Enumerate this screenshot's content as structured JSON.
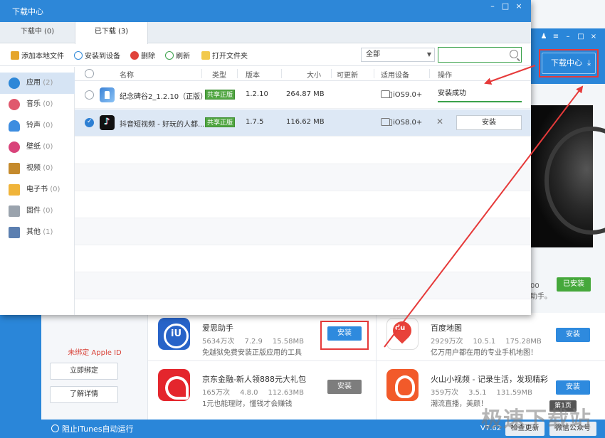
{
  "background": {
    "download_center_btn": "下载中心",
    "unbind_label": "未绑定 Apple ID",
    "bind_now": "立即绑定",
    "learn_more": "了解详情",
    "peek_text": [
      "00",
      "助手。"
    ],
    "installed_btn": "已安装",
    "apps": [
      {
        "name": "爱思助手",
        "downloads": "5634万次",
        "version": "7.2.9",
        "size": "15.58MB",
        "desc": "免越狱免费安装正版应用的工具",
        "button": "安装"
      },
      {
        "name": "百度地图",
        "downloads": "2929万次",
        "version": "10.5.1",
        "size": "175.28MB",
        "desc": "亿万用户都在用的专业手机地图！",
        "button": "安装"
      },
      {
        "name": "京东金融-新人领888元大礼包",
        "downloads": "165万次",
        "version": "4.8.0",
        "size": "112.63MB",
        "desc": "1元也能理财，懂钱才会赚钱",
        "button": "安装"
      },
      {
        "name": "火山小视频 - 记录生活，发现精彩",
        "downloads": "359万次",
        "version": "3.5.1",
        "size": "131.59MB",
        "desc": "潮流直播，美颜！",
        "button": "安装"
      }
    ],
    "status_bar": {
      "itunes_block": "阻止iTunes自动运行",
      "version": "V7.62",
      "check_update": "检查更新",
      "wechat": "微信公众号"
    },
    "page_badge": "第1页",
    "watermark": "极速下载站"
  },
  "dialog": {
    "title": "下载中心",
    "tabs": [
      {
        "label": "下载中 (0)"
      },
      {
        "label": "已下载 (3)"
      }
    ],
    "toolbar": {
      "add_local": "添加本地文件",
      "install_device": "安装到设备",
      "delete": "删除",
      "refresh": "刷新",
      "open_folder": "打开文件夹"
    },
    "filter_selected": "全部",
    "search_placeholder": "",
    "sidebar": [
      {
        "label": "应用",
        "count": "(2)"
      },
      {
        "label": "音乐",
        "count": "(0)"
      },
      {
        "label": "铃声",
        "count": "(0)"
      },
      {
        "label": "壁纸",
        "count": "(0)"
      },
      {
        "label": "视频",
        "count": "(0)"
      },
      {
        "label": "电子书",
        "count": "(0)"
      },
      {
        "label": "固件",
        "count": "(0)"
      },
      {
        "label": "其他",
        "count": "(1)"
      }
    ],
    "columns": {
      "name": "名称",
      "type": "类型",
      "version": "版本",
      "size": "大小",
      "updatable": "可更新",
      "device": "适用设备",
      "action": "操作"
    },
    "rows": [
      {
        "name": "纪念碑谷2_1.2.10（正版）",
        "type": "共享正版",
        "version": "1.2.10",
        "size": "264.87 MB",
        "device": "iOS9.0+",
        "status": "安装成功",
        "progress": 100
      },
      {
        "name": "抖音短视频 - 好玩的人都...",
        "type": "共享正版",
        "version": "1.7.5",
        "size": "116.62 MB",
        "device": "iOS8.0+",
        "button": "安装"
      }
    ]
  },
  "colors": {
    "titlebar": "#2d87d8",
    "accent_green": "#3aa14a",
    "highlight_red": "#e63a3a"
  }
}
